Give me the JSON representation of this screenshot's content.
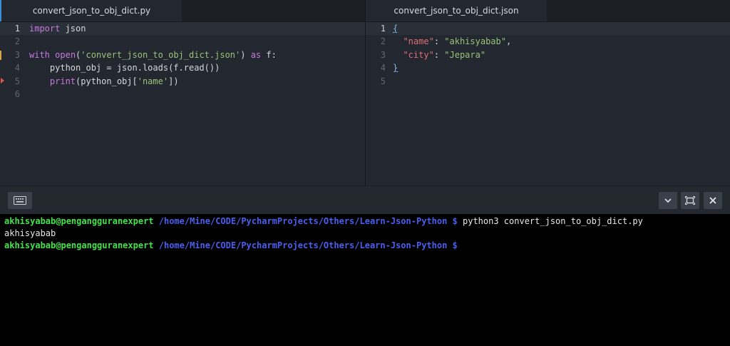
{
  "left_pane": {
    "tab_title": "convert_json_to_obj_dict.py",
    "lines": [
      {
        "num": "1",
        "active": true
      },
      {
        "num": "2"
      },
      {
        "num": "3",
        "modified": true
      },
      {
        "num": "4"
      },
      {
        "num": "5",
        "error": true
      },
      {
        "num": "6"
      }
    ],
    "code": {
      "l1_kw": "import",
      "l1_rest": " json",
      "l3_kw": "with",
      "l3_fn": "open",
      "l3_p1": "(",
      "l3_str": "'convert_json_to_obj_dict.json'",
      "l3_p2": ") ",
      "l3_as": "as",
      "l3_rest": " f:",
      "l4": "    python_obj = json.loads(f.read())",
      "l5_indent": "    ",
      "l5_fn": "print",
      "l5_p1": "(python_obj[",
      "l5_str": "'name'",
      "l5_p2": "])"
    }
  },
  "right_pane": {
    "tab_title": "convert_json_to_obj_dict.json",
    "lines": [
      {
        "num": "1",
        "active": true
      },
      {
        "num": "2"
      },
      {
        "num": "3"
      },
      {
        "num": "4"
      },
      {
        "num": "5"
      }
    ],
    "code": {
      "l1": "{",
      "l2_indent": "  ",
      "l2_key": "\"name\"",
      "l2_colon": ": ",
      "l2_val": "\"akhisyabab\"",
      "l2_comma": ",",
      "l3_indent": "  ",
      "l3_key": "\"city\"",
      "l3_colon": ": ",
      "l3_val": "\"Jepara\"",
      "l4": "}"
    }
  },
  "toolbar": {
    "keyboard_icon": "keyboard-icon",
    "chevron_icon": "chevron-down-icon",
    "maximize_icon": "maximize-icon",
    "close_icon": "close-icon"
  },
  "terminal": {
    "user_host": "akhisyabab@pengangguranexpert",
    "path": " /home/Mine/CODE/PycharmProjects/Others/Learn-Json-Python $",
    "command": " python3 convert_json_to_obj_dict.py",
    "output": "akhisyabab",
    "user_host_2": "akhisyabab@pengangguranexpert",
    "path_2": " /home/Mine/CODE/PycharmProjects/Others/Learn-Json-Python $"
  },
  "colors": {
    "background": "#232830",
    "terminal_bg": "#000000",
    "prompt_user": "#44e34c",
    "prompt_path": "#4a5ff0",
    "keyword": "#c678dd",
    "string": "#98c379",
    "json_key": "#e06c75"
  }
}
